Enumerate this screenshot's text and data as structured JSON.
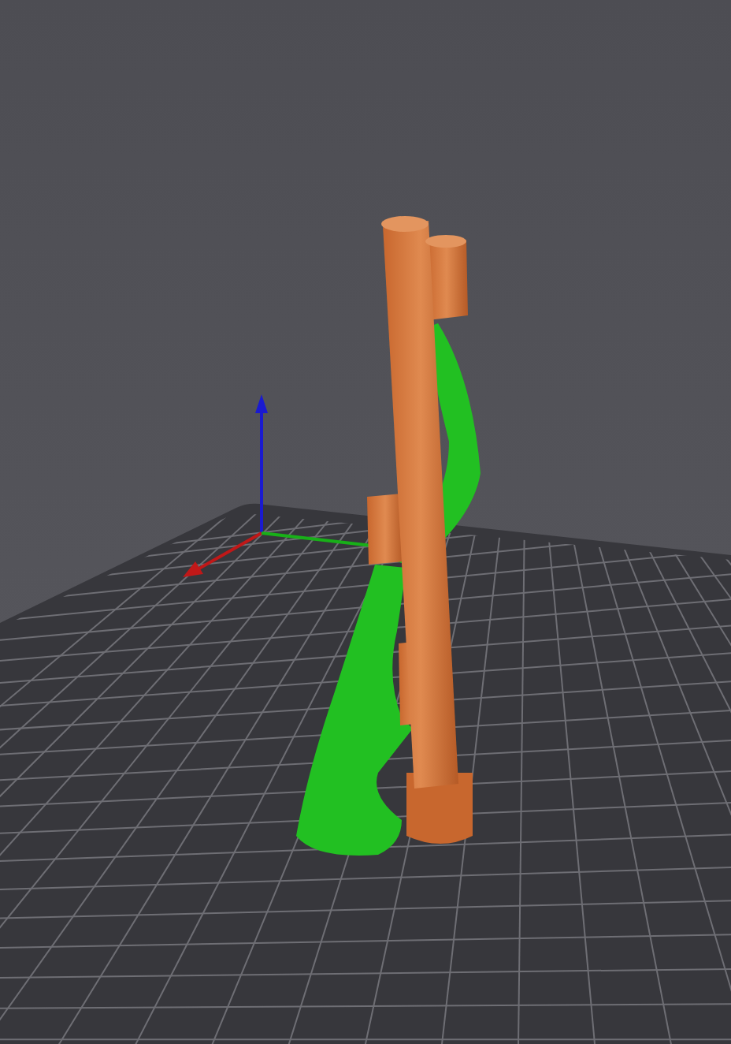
{
  "scene": {
    "kind": "print-preview"
  }
}
